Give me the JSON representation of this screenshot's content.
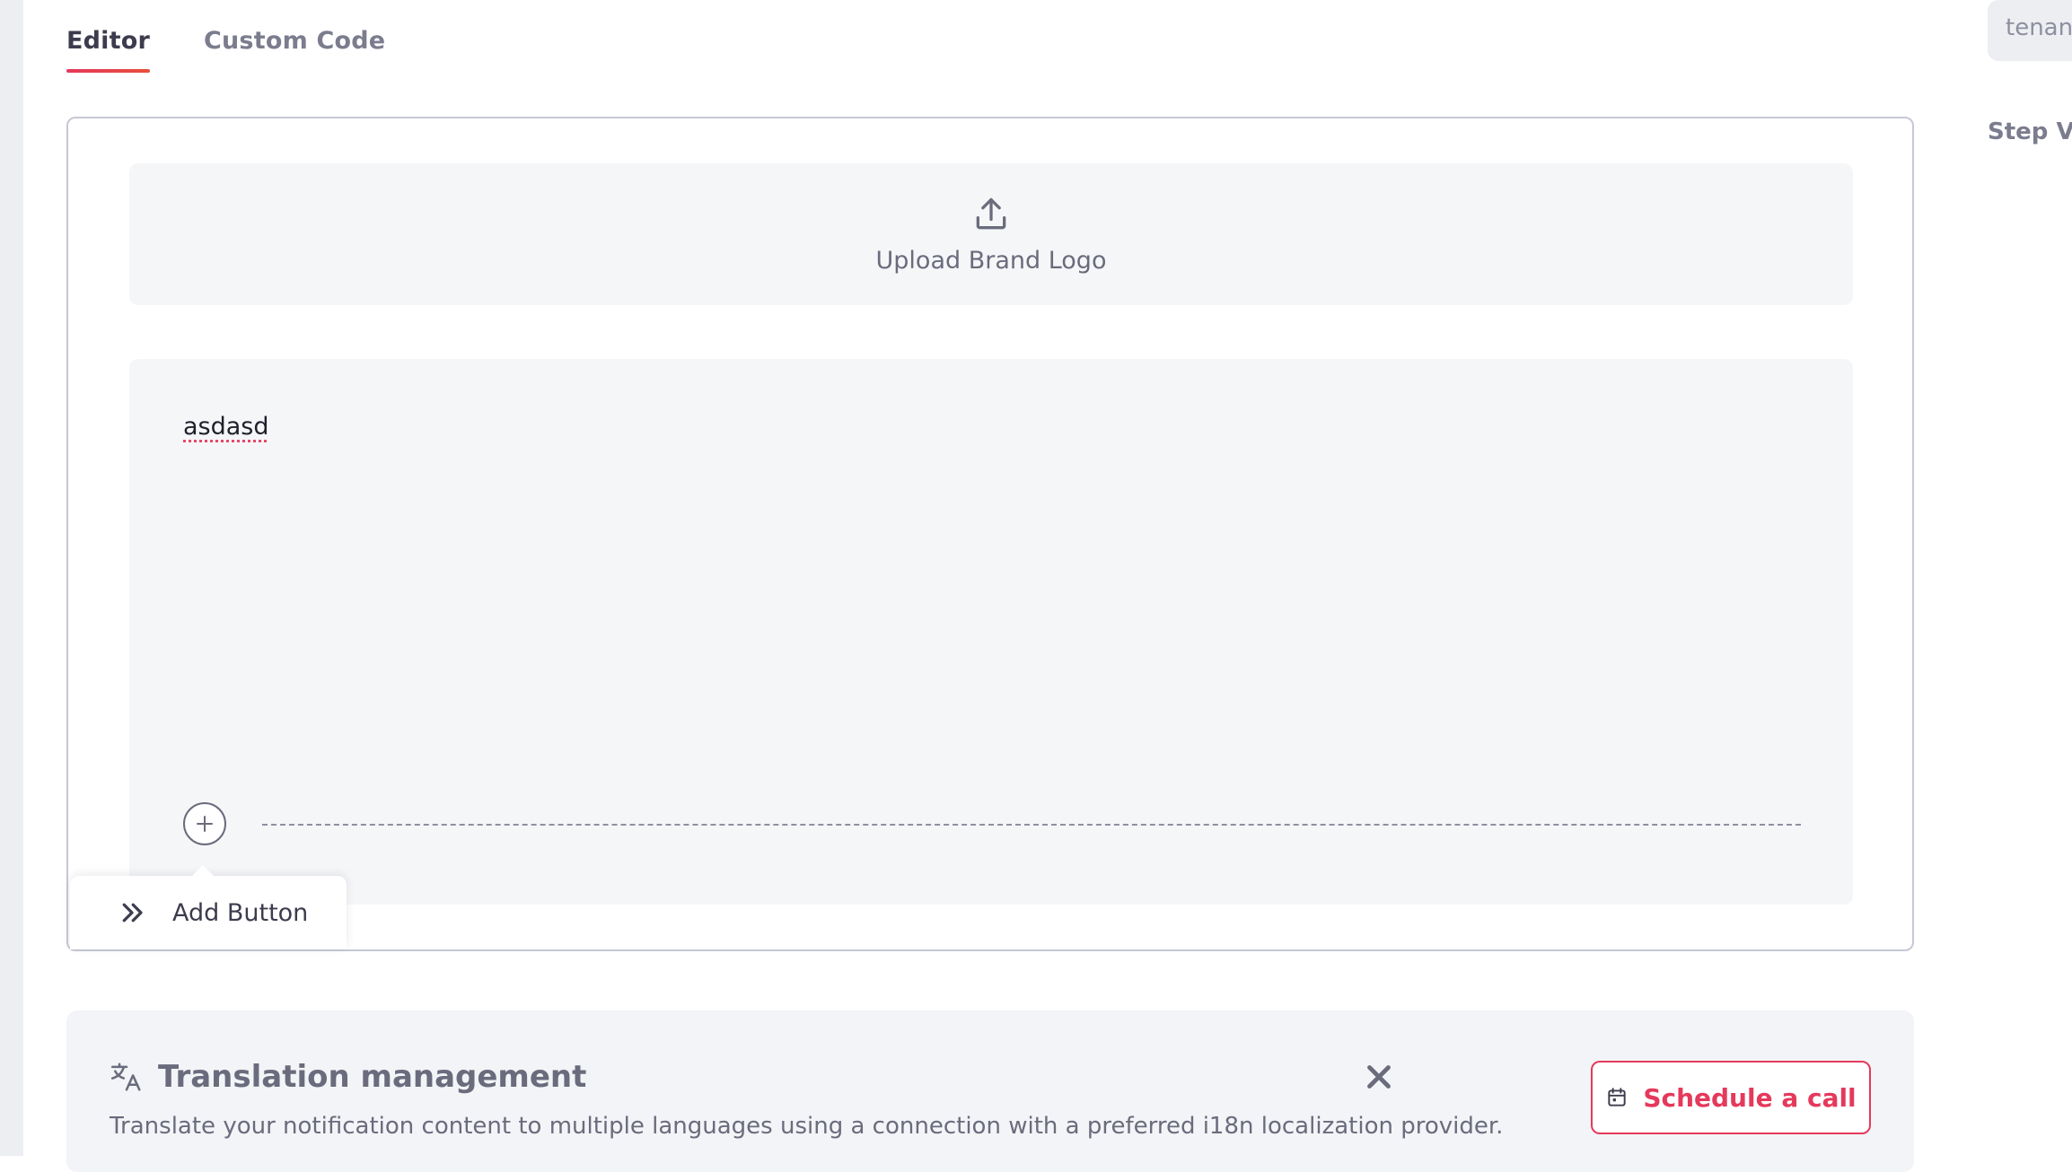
{
  "tabs": [
    {
      "label": "Editor",
      "active": true
    },
    {
      "label": "Custom Code",
      "active": false
    }
  ],
  "editor": {
    "upload_logo_label": "Upload Brand Logo",
    "body_text": "asdasd",
    "add_button_label": "Add Button"
  },
  "translation": {
    "title": "Translation management",
    "description": "Translate your notification content to multiple languages using a connection with a preferred i18n localization provider.",
    "schedule_label": "Schedule a call"
  },
  "sidebar_right": {
    "tenant_text": "tenant",
    "step_label": "Step Va"
  },
  "colors": {
    "accent": "#e5395c",
    "text_muted": "#6a6b7c",
    "surface": "#f5f6f8"
  },
  "icons": {
    "upload": "upload-icon",
    "plus": "plus-icon",
    "double_chevron": "double-chevron-right-icon",
    "translate": "translate-icon",
    "close": "close-icon",
    "calendar": "calendar-icon"
  }
}
